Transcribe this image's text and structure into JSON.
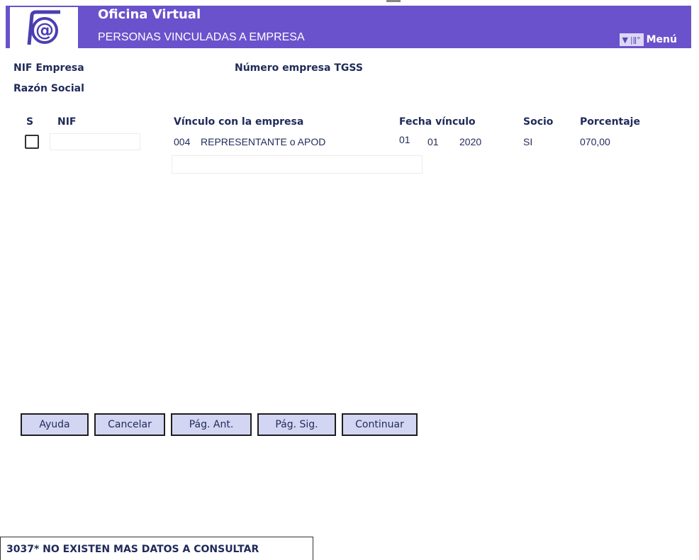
{
  "header": {
    "title": "Oficina Virtual",
    "subtitle": "PERSONAS VINCULADAS A EMPRESA",
    "menu_label": "Menú",
    "logo_icon": "at-sign-logo",
    "menu_icons": [
      "down-arrow-icon",
      "bars-icon"
    ]
  },
  "company": {
    "nif_label": "NIF Empresa",
    "tgss_label": "Número empresa TGSS",
    "razon_label": "Razón Social"
  },
  "table": {
    "headers": {
      "s": "S",
      "nif": "NIF",
      "vinculo": "Vínculo con la empresa",
      "fecha": "Fecha vínculo",
      "socio": "Socio",
      "porcentaje": "Porcentaje"
    },
    "rows": [
      {
        "vinculo_code": "004",
        "vinculo_text": "REPRESENTANTE o APOD",
        "fecha_dia": "01",
        "fecha_mes": "01",
        "fecha_anio": "2020",
        "socio": "SI",
        "porcentaje": "070,00"
      }
    ]
  },
  "buttons": {
    "ayuda": "Ayuda",
    "cancelar": "Cancelar",
    "pag_ant": "Pág. Ant.",
    "pag_sig": "Pág. Sig.",
    "continuar": "Continuar"
  },
  "status": {
    "message": "3037* NO EXISTEN MAS DATOS A CONSULTAR"
  },
  "colors": {
    "header_bg": "#6a52cc",
    "button_bg": "#d3d6f2",
    "text": "#1f2a5a"
  }
}
